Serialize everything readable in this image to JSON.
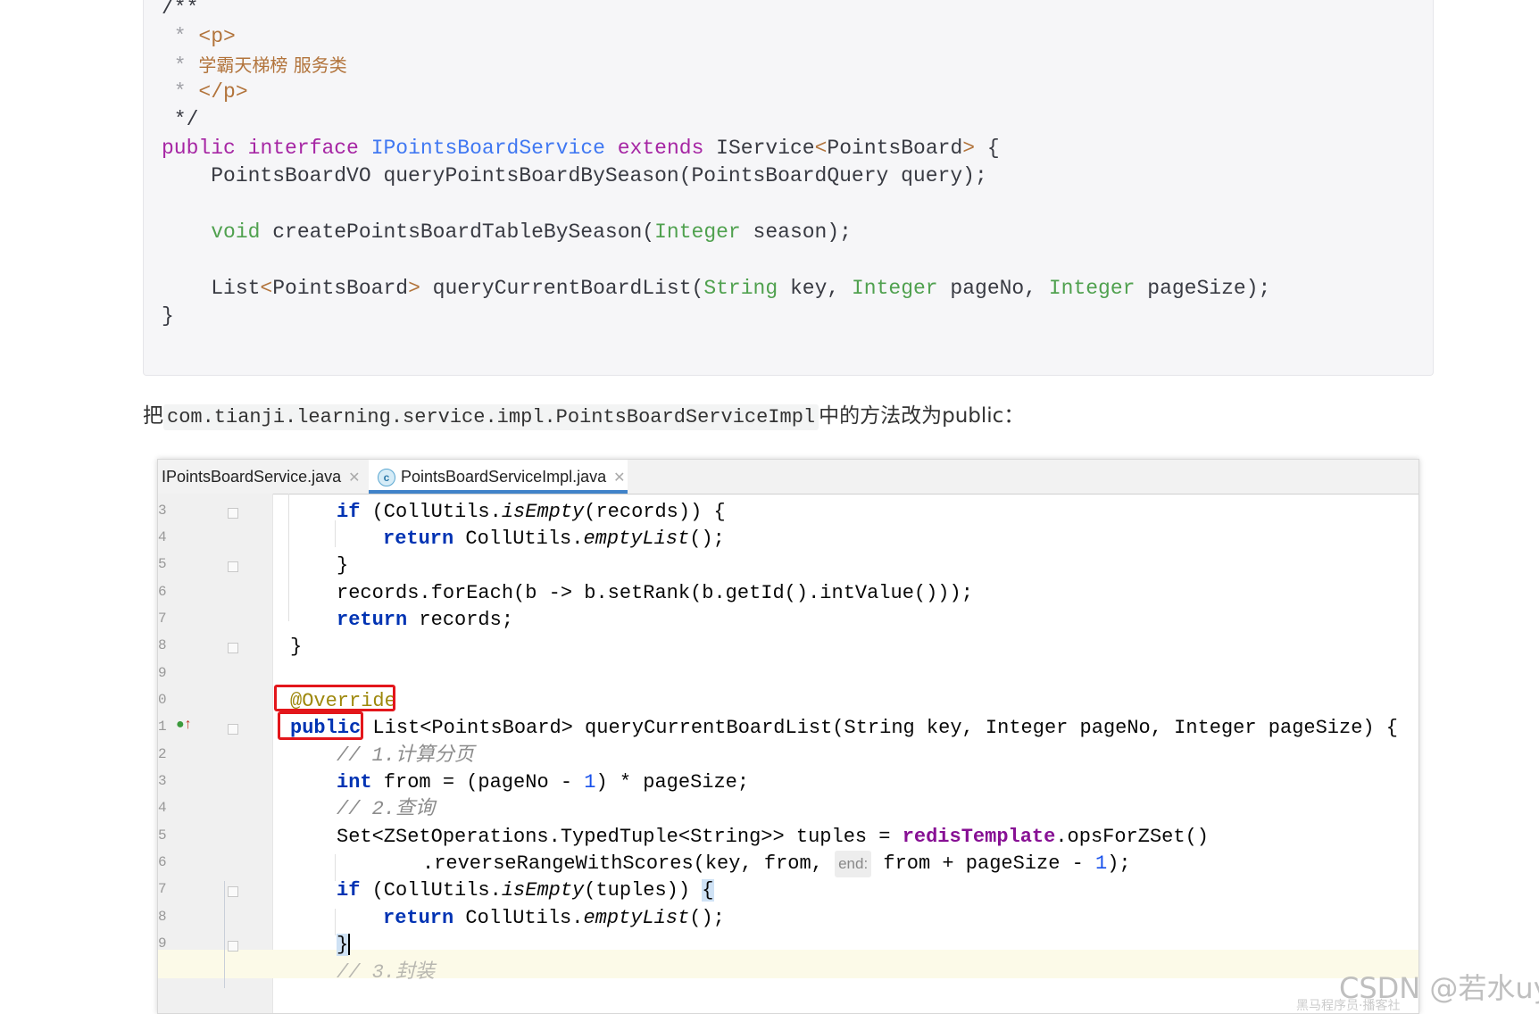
{
  "code_block": {
    "lines": [
      "/**",
      " * <p>",
      " * 学霸天梯榜 服务类",
      " * </p>",
      " */",
      "public interface IPointsBoardService extends IService<PointsBoard> {",
      "    PointsBoardVO queryPointsBoardBySeason(PointsBoardQuery query);",
      "",
      "    void createPointsBoardTableBySeason(Integer season);",
      "",
      "    List<PointsBoard> queryCurrentBoardList(String key, Integer pageNo, Integer pageSize);",
      "}"
    ]
  },
  "paragraph": {
    "prefix": "把",
    "code": "com.tianji.learning.service.impl.PointsBoardServiceImpl",
    "suffix": "中的方法改为public："
  },
  "ide": {
    "tabs": [
      {
        "label": "IPointsBoardService.java",
        "active": false
      },
      {
        "label": "PointsBoardServiceImpl.java",
        "active": true
      }
    ],
    "line_numbers": [
      "3",
      "4",
      "5",
      "6",
      "7",
      "8",
      "9",
      "0",
      "1",
      "2",
      "3",
      "4",
      "5",
      "6",
      "7",
      "8",
      "9"
    ],
    "code_lines": [
      "if (CollUtils.isEmpty(records)) {",
      "return CollUtils.emptyList();",
      "}",
      "records.forEach(b -> b.setRank(b.getId().intValue()));",
      "return records;",
      "}",
      "",
      "@Override",
      "public List<PointsBoard> queryCurrentBoardList(String key, Integer pageNo, Integer pageSize) {",
      "// 1.计算分页",
      "int from = (pageNo - 1) * pageSize;",
      "// 2.查询",
      "Set<ZSetOperations.TypedTuple<String>> tuples = redisTemplate.opsForZSet()",
      ".reverseRangeWithScores(key, from, end: from + pageSize - 1);",
      "if (CollUtils.isEmpty(tuples)) {",
      "return CollUtils.emptyList();",
      "}"
    ],
    "param_hint": "end:",
    "last_partial": "// 3.封装"
  },
  "watermark": {
    "main": "CSDN @若水uy",
    "sub": "黑马程序员·播客社"
  }
}
